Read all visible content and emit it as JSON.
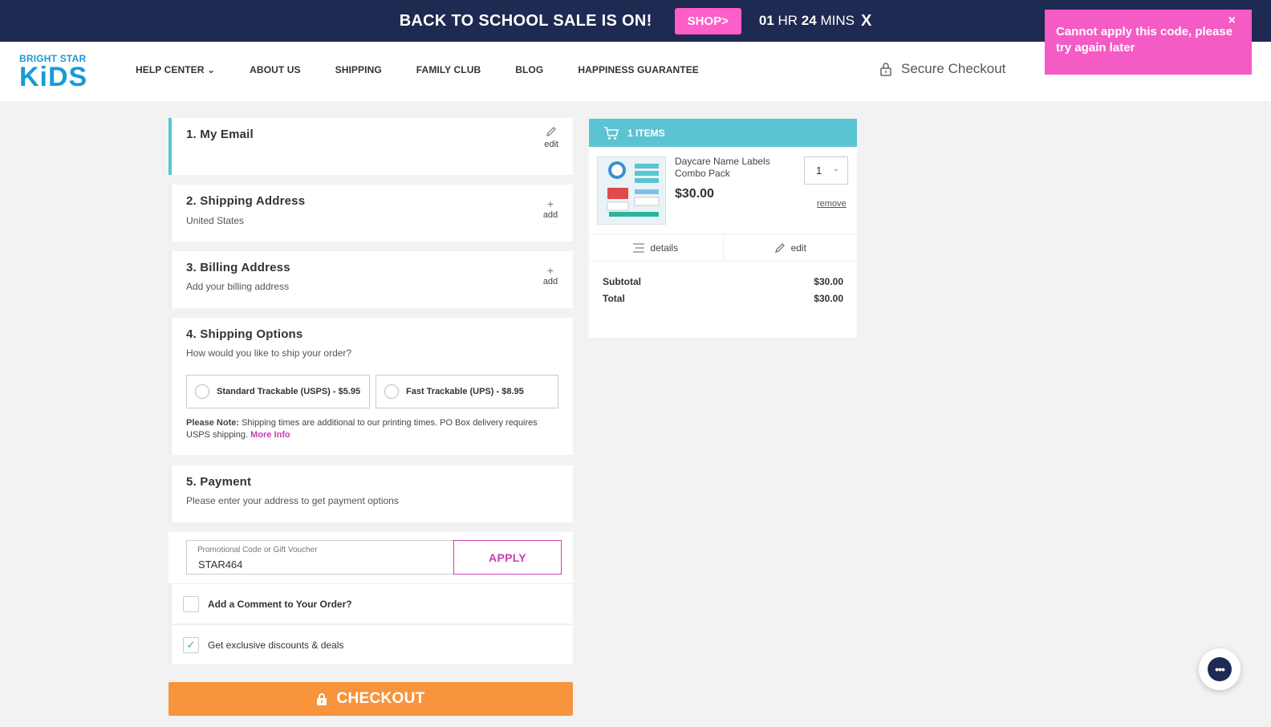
{
  "promo_bar": {
    "text": "BACK TO SCHOOL SALE IS ON!",
    "shop_label": "SHOP>",
    "timer_hours": "01",
    "timer_hr_label": "HR",
    "timer_mins": "24",
    "timer_min_label": "MINS",
    "close_glyph": "X"
  },
  "header": {
    "logo_top": "BRIGHT STAR",
    "logo_bottom": "KiDS",
    "nav": [
      "HELP CENTER",
      "ABOUT US",
      "SHIPPING",
      "FAMILY CLUB",
      "BLOG",
      "HAPPINESS GUARANTEE"
    ],
    "secure_label": "Secure Checkout"
  },
  "toast": {
    "message": "Cannot apply this code, please try again later",
    "close_glyph": "×",
    "color": "#f55bc4"
  },
  "steps": {
    "email": {
      "title": "1. My Email",
      "action": "edit"
    },
    "shipping_address": {
      "title": "2. Shipping Address",
      "subtitle": "United States",
      "action": "add"
    },
    "billing_address": {
      "title": "3. Billing Address",
      "subtitle": "Add your billing address",
      "action": "add"
    },
    "shipping_options": {
      "title": "4. Shipping Options",
      "subtitle": "How would you like to ship your order?",
      "options": [
        "Standard Trackable (USPS) - $5.95",
        "Fast Trackable (UPS) - $8.95"
      ],
      "note_label": "Please Note:",
      "note_text": " Shipping times are additional to our printing times. PO Box delivery requires USPS shipping. ",
      "more_info": "More Info"
    },
    "payment": {
      "title": "5. Payment",
      "subtitle": "Please enter your address to get payment options"
    }
  },
  "promo_code": {
    "label": "Promotional Code or Gift Voucher",
    "value": "STAR464",
    "apply_label": "APPLY"
  },
  "options": {
    "comment_label": "Add a Comment to Your Order?",
    "comment_checked": false,
    "discounts_label": "Get exclusive discounts & deals",
    "discounts_checked": true
  },
  "checkout_label": "CHECKOUT",
  "cart": {
    "header": "1 ITEMS",
    "product_name": "Daycare Name Labels Combo Pack",
    "product_price": "$30.00",
    "quantity": "1",
    "remove_label": "remove",
    "details_label": "details",
    "edit_label": "edit",
    "subtotal_label": "Subtotal",
    "subtotal_value": "$30.00",
    "total_label": "Total",
    "total_value": "$30.00"
  },
  "colors": {
    "promo_bg": "#1f2a52",
    "shop_btn": "#ff5ec8",
    "accent_teal": "#5bc4d2",
    "accent_magenta": "#c540b2",
    "checkout_orange": "#f7943c"
  }
}
